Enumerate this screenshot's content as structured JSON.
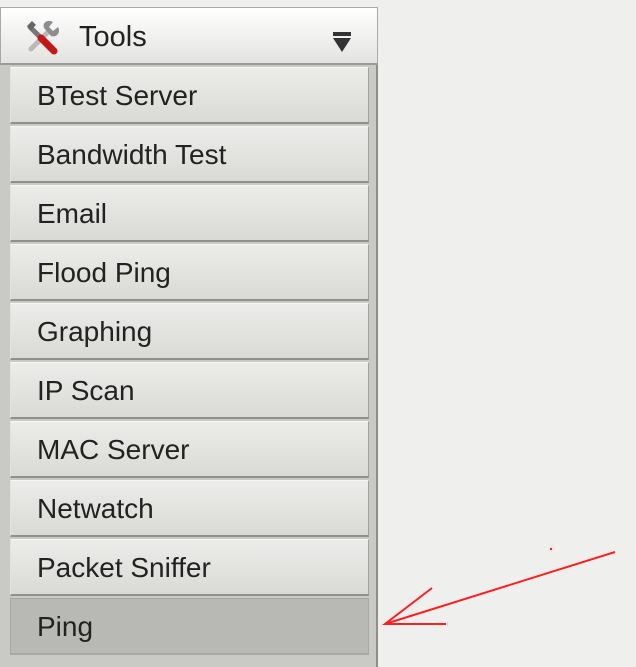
{
  "header": {
    "icon": "tools-icon",
    "label": "Tools",
    "dropdown_icon": "dropdown-arrow-icon"
  },
  "menu": {
    "items": [
      {
        "label": "BTest Server",
        "active": false
      },
      {
        "label": "Bandwidth Test",
        "active": false
      },
      {
        "label": "Email",
        "active": false
      },
      {
        "label": "Flood Ping",
        "active": false
      },
      {
        "label": "Graphing",
        "active": false
      },
      {
        "label": "IP Scan",
        "active": false
      },
      {
        "label": "MAC Server",
        "active": false
      },
      {
        "label": "Netwatch",
        "active": false
      },
      {
        "label": "Packet Sniffer",
        "active": false
      },
      {
        "label": "Ping",
        "active": true
      }
    ]
  },
  "annotation": {
    "color": "#ff1f1f",
    "points_to": "Ping"
  },
  "colors": {
    "page_background": "#eff0ee",
    "menu_text": "#222222",
    "active_item": "#b8b8b5"
  }
}
